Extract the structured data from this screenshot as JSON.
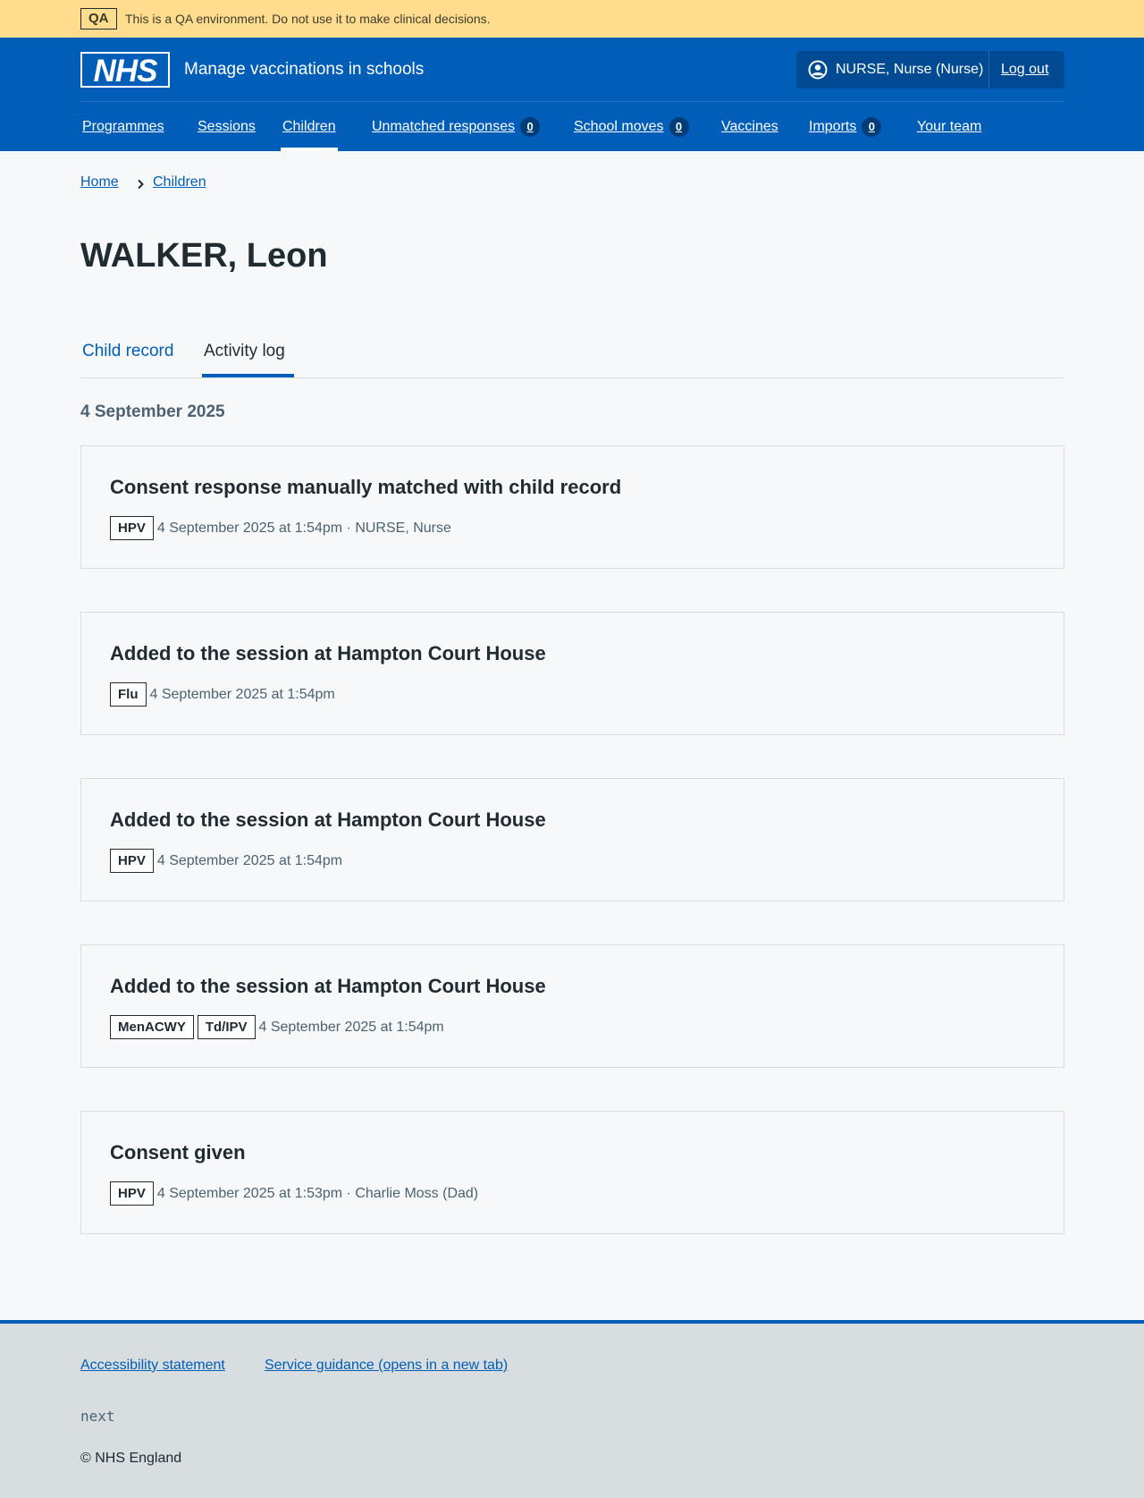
{
  "qa_banner": {
    "tag": "QA",
    "text": "This is a QA environment. Do not use it to make clinical decisions."
  },
  "header": {
    "logo_text": "NHS",
    "service_name": "Manage vaccinations in schools",
    "account": {
      "user_name": "NURSE, Nurse (Nurse)",
      "logout_label": "Log out"
    },
    "nav": [
      {
        "label": "Programmes"
      },
      {
        "label": "Sessions"
      },
      {
        "label": "Children",
        "active": true
      },
      {
        "label": "Unmatched responses",
        "count": "0"
      },
      {
        "label": "School moves",
        "count": "0"
      },
      {
        "label": "Vaccines"
      },
      {
        "label": "Imports",
        "count": "0"
      },
      {
        "label": "Your team"
      }
    ]
  },
  "breadcrumb": {
    "home": "Home",
    "children": "Children"
  },
  "page_title": "WALKER, Leon",
  "tabs": {
    "child_record": "Child record",
    "activity_log": "Activity log"
  },
  "date_heading": "4 September 2025",
  "activities": [
    {
      "title": "Consent response manually matched with child record",
      "tags": [
        "HPV"
      ],
      "meta": "4 September 2025 at 1:54pm · NURSE, Nurse"
    },
    {
      "title": "Added to the session at Hampton Court House",
      "tags": [
        "Flu"
      ],
      "meta": "4 September 2025 at 1:54pm"
    },
    {
      "title": "Added to the session at Hampton Court House",
      "tags": [
        "HPV"
      ],
      "meta": "4 September 2025 at 1:54pm"
    },
    {
      "title": "Added to the session at Hampton Court House",
      "tags": [
        "MenACWY",
        "Td/IPV"
      ],
      "meta": "4 September 2025 at 1:54pm"
    },
    {
      "title": "Consent given",
      "tags": [
        "HPV"
      ],
      "meta": "4 September 2025 at 1:53pm · Charlie Moss (Dad)"
    }
  ],
  "footer": {
    "accessibility_link": "Accessibility statement",
    "guidance_link": "Service guidance (opens in a new tab)",
    "version": "next",
    "copyright": "© NHS England"
  },
  "colors": {
    "nhs_blue": "#005eb8",
    "qa_banner": "#ffdc8e",
    "footer_bg": "#d8dde0",
    "text": "#212b32",
    "secondary_text": "#4c6272"
  },
  "icons": {
    "user": "user-circle-icon",
    "breadcrumb_separator": "chevron-right-icon"
  }
}
